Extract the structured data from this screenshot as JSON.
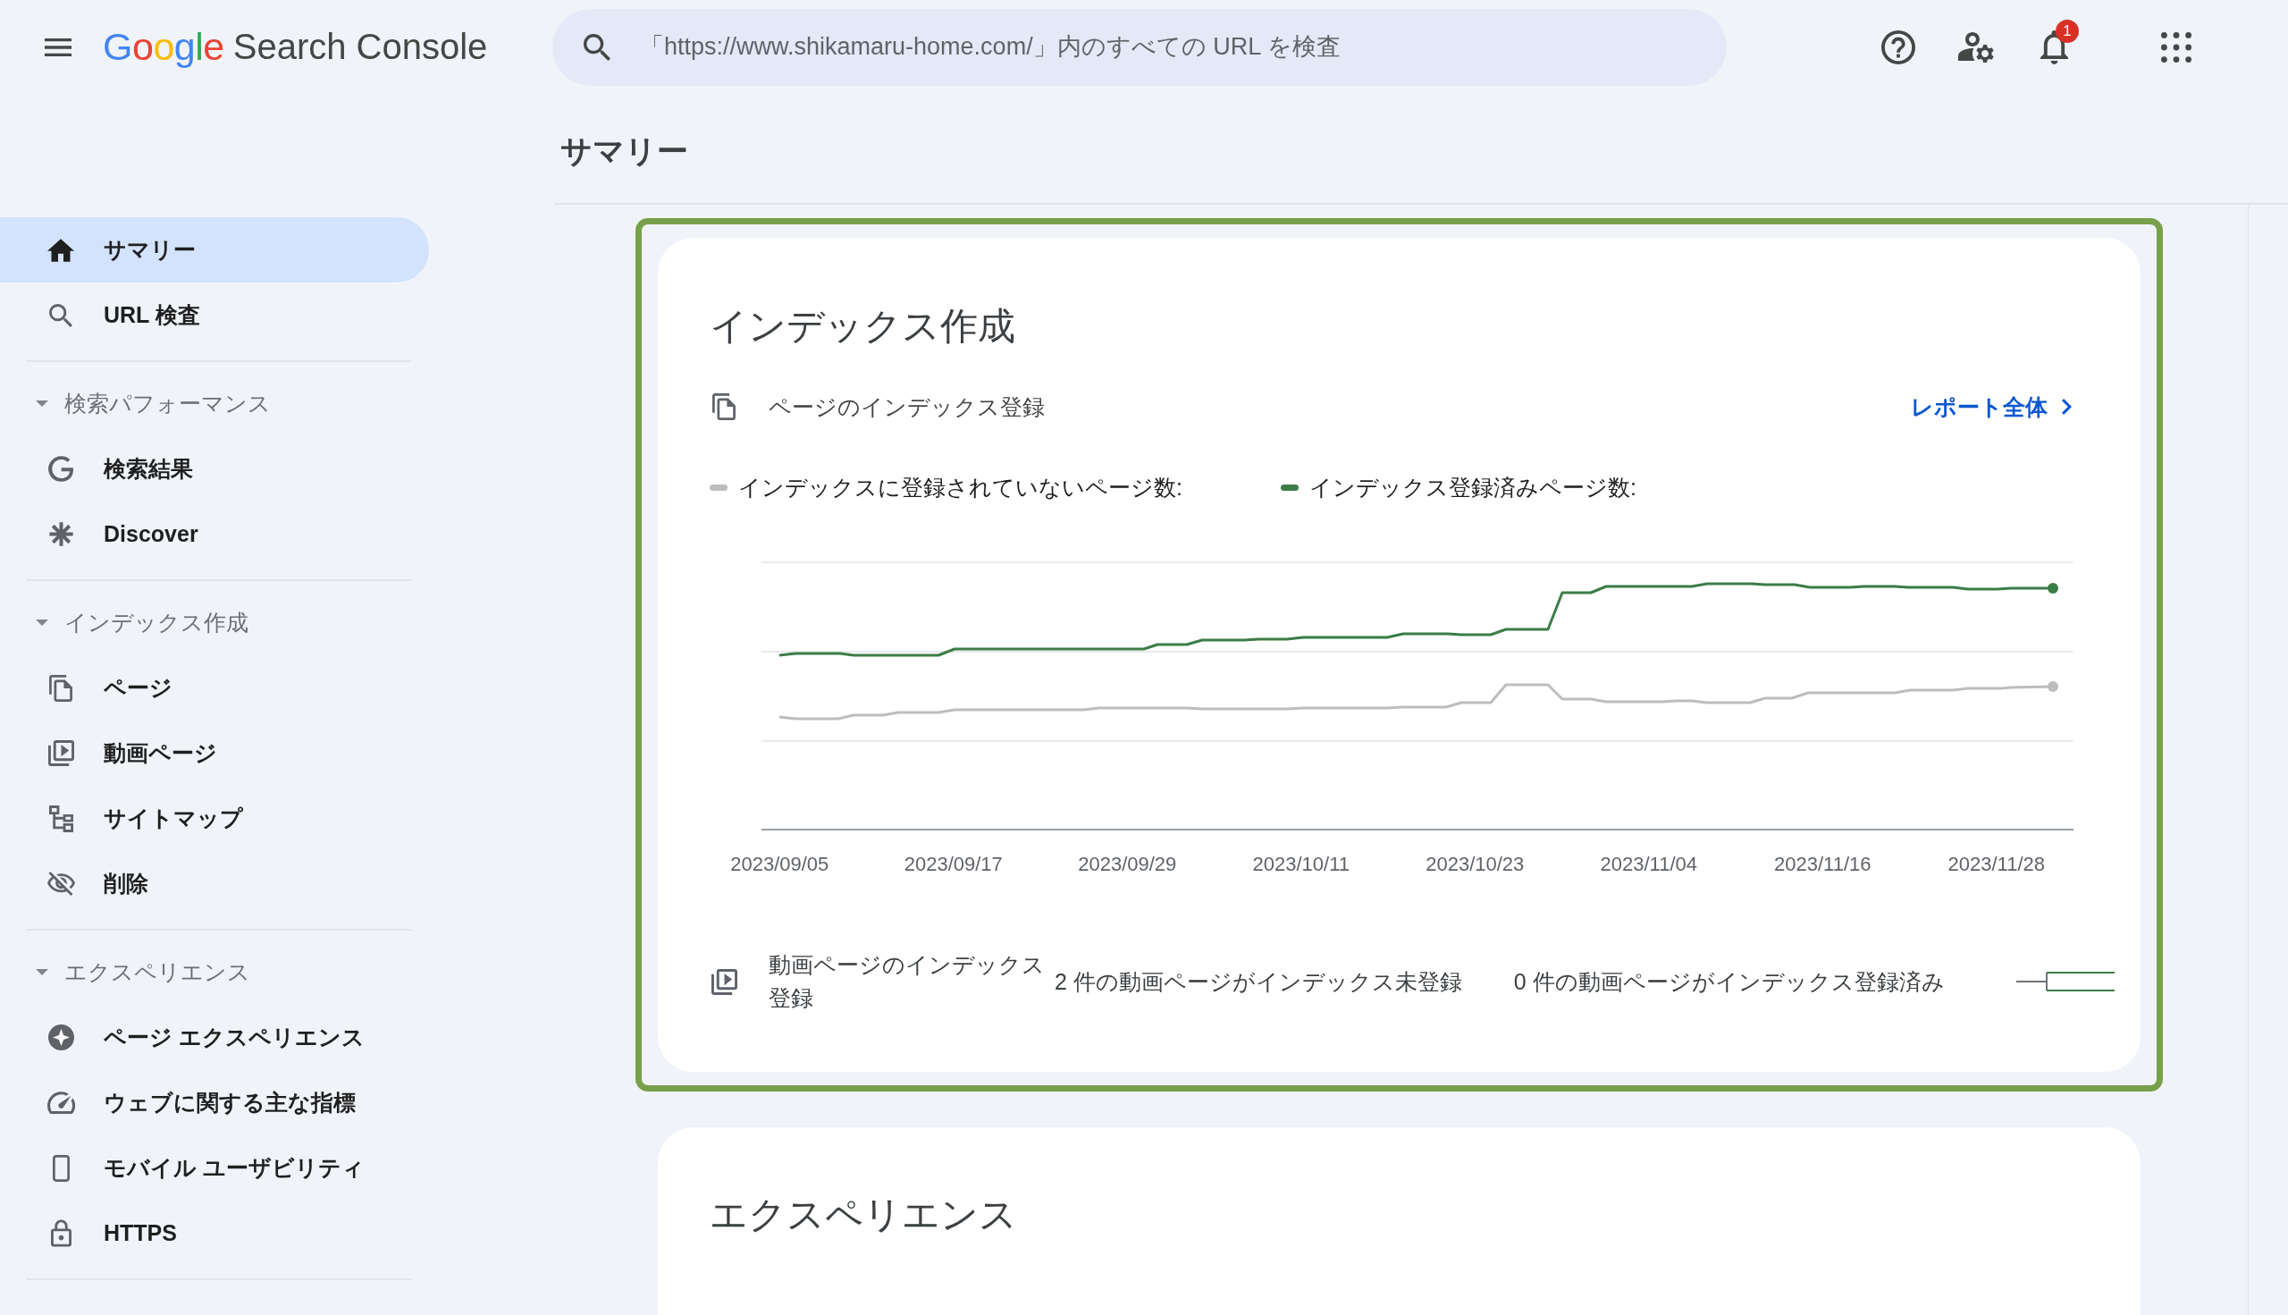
{
  "top_bar": {
    "brand": "Google",
    "product": "Search Console",
    "search": {
      "placeholder": "「https://www.shikamaru-home.com/」内のすべての URL を検査"
    },
    "notifications": {
      "badge": "1"
    }
  },
  "page": {
    "title": "サマリー"
  },
  "sidebar": {
    "top_items": [
      {
        "label": "サマリー",
        "selected": true
      },
      {
        "label": "URL 検査",
        "selected": false
      }
    ],
    "sections": [
      {
        "title": "検索パフォーマンス",
        "expanded": true,
        "items": [
          {
            "label": "検索結果",
            "selected": false
          },
          {
            "label": "Discover",
            "selected": false
          }
        ]
      },
      {
        "title": "インデックス作成",
        "expanded": true,
        "items": [
          {
            "label": "ページ",
            "selected": false
          },
          {
            "label": "動画ページ",
            "selected": false
          },
          {
            "label": "サイトマップ",
            "selected": false
          },
          {
            "label": "削除",
            "selected": false
          }
        ]
      },
      {
        "title": "エクスペリエンス",
        "expanded": true,
        "items": [
          {
            "label": "ページ エクスペリエンス",
            "selected": false
          },
          {
            "label": "ウェブに関する主な指標",
            "selected": false
          },
          {
            "label": "モバイル ユーザビリティ",
            "selected": false
          },
          {
            "label": "HTTPS",
            "selected": false
          }
        ]
      }
    ]
  },
  "indexing_card": {
    "title": "インデックス作成",
    "highlighted": true,
    "page_report": {
      "label": "ページのインデックス登録",
      "link": "レポート全体"
    },
    "chart": {
      "series": [
        {
          "name": "インデックスに登録されていないページ数:",
          "color": "#bdbdbd"
        },
        {
          "name": "インデックス登録済みページ数:",
          "color": "#3b7d46"
        }
      ],
      "x_labels": [
        "2023/09/05",
        "2023/09/17",
        "2023/09/29",
        "2023/10/11",
        "2023/10/23",
        "2023/11/04",
        "2023/11/16",
        "2023/11/28"
      ]
    },
    "video_report": {
      "label": "動画ページのインデックス登録",
      "not_indexed": "2 件の動画ページがインデックス未登録",
      "indexed": "0 件の動画ページがインデックス登録済み"
    }
  },
  "experience_card": {
    "title": "エクスペリエンス"
  }
}
